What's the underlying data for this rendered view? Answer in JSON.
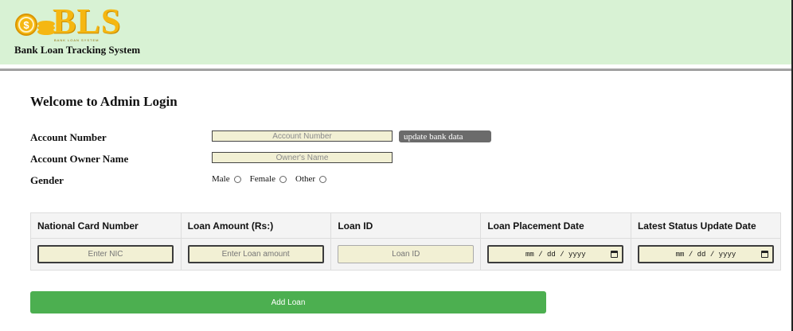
{
  "header": {
    "logo_text": "BLS",
    "logo_tagline": "BANK LOAN SYSTEM",
    "site_title": "Bank Loan Tracking System",
    "background_color": "#d8f2d4",
    "logo_color": "#f5b712",
    "logo_icon": "coins-icon"
  },
  "main": {
    "page_title": "Welcome to Admin Login",
    "account_number": {
      "label": "Account Number",
      "placeholder": "Account Number",
      "value": ""
    },
    "update_button_label": "update bank data",
    "owner_name": {
      "label": "Account Owner Name",
      "placeholder": "Owner's Name",
      "value": ""
    },
    "gender": {
      "label": "Gender",
      "options": [
        {
          "label": "Male",
          "selected": false
        },
        {
          "label": "Female",
          "selected": false
        },
        {
          "label": "Other",
          "selected": false
        }
      ]
    }
  },
  "table": {
    "headers": [
      "National Card Number",
      "Loan Amount (Rs:)",
      "Loan ID",
      "Loan Placement Date",
      "Latest Status Update Date"
    ],
    "inputs": {
      "nic_placeholder": "Enter NIC",
      "amount_placeholder": "Enter Loan amount",
      "loan_id_placeholder": "Loan ID",
      "placement_date_value": "mm / dd / yyyy",
      "status_date_value": "mm / dd / yyyy"
    }
  },
  "add_button_label": "Add Loan",
  "colors": {
    "add_button": "#4caf50",
    "update_button": "#6b6b6b",
    "input_background": "#f2f0d4"
  }
}
